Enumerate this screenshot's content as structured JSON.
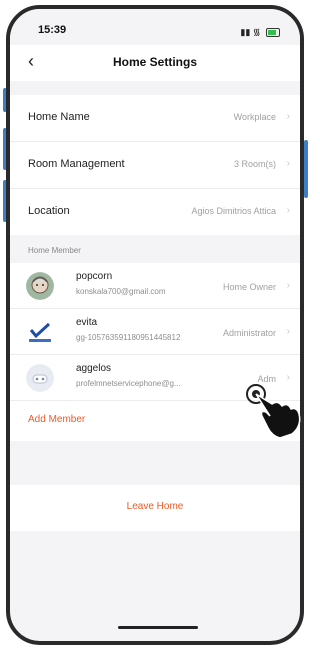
{
  "status": {
    "time": "15:39"
  },
  "nav": {
    "title": "Home Settings",
    "back_icon": "chevron-left-icon"
  },
  "settings": [
    {
      "label": "Home Name",
      "value": "Workplace"
    },
    {
      "label": "Room Management",
      "value": "3 Room(s)"
    },
    {
      "label": "Location",
      "value": "Agios Dimitrios Attica"
    }
  ],
  "members_section": {
    "title": "Home Member"
  },
  "members": [
    {
      "name": "popcorn",
      "sub": "konskala700@gmail.com",
      "role": "Home Owner"
    },
    {
      "name": "evita",
      "sub": "gg-105763591180951445812",
      "role": "Administrator"
    },
    {
      "name": "aggelos",
      "sub": "profelmnetservicephone@g...",
      "role": "Adm"
    }
  ],
  "add_member_label": "Add Member",
  "leave_home_label": "Leave Home",
  "colors": {
    "accent": "#ee5a24",
    "background": "#f4f4f6",
    "frame_button": "#3d7fc4"
  }
}
